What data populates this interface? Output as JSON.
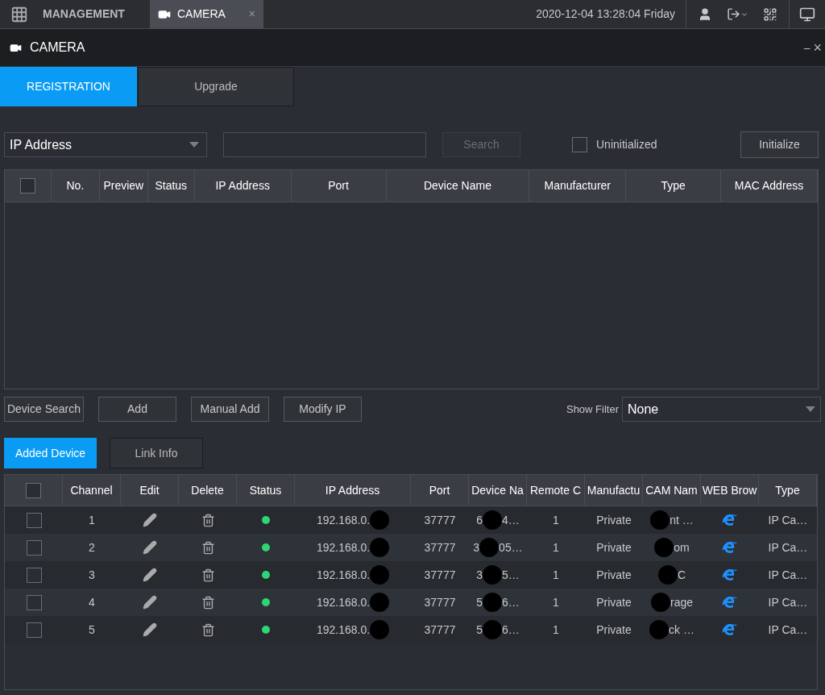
{
  "top_bar": {
    "menu_label": "MANAGEMENT",
    "tabs": [
      {
        "label": "CAMERA",
        "selected": true,
        "close": "×"
      }
    ],
    "datetime": "2020-12-04 13:28:04 Friday"
  },
  "window": {
    "title": "CAMERA",
    "minimize": "–",
    "close": "×"
  },
  "tabs": [
    {
      "label": "REGISTRATION",
      "selected": true
    },
    {
      "label": "Upgrade",
      "selected": false
    }
  ],
  "search_row": {
    "dropdown": "IP Address",
    "search_button": "Search",
    "search_disabled": true,
    "uninitialized": {
      "label": "Uninitialized",
      "checked": false
    },
    "initialize_button": "Initialize"
  },
  "found_table": {
    "select_all": {
      "checked": false
    },
    "columns": [
      "No.",
      "Preview",
      "Status",
      "IP Address",
      "Port",
      "Device Name",
      "Manufacturer",
      "Type",
      "MAC Address"
    ]
  },
  "actions": [
    "Device Search",
    "Add",
    "Manual Add",
    "Modify IP"
  ],
  "show_filter": {
    "label": "Show Filter",
    "value": "None"
  },
  "sub_tabs": [
    {
      "label": "Added Device",
      "selected": true
    },
    {
      "label": "Link Info",
      "selected": false
    }
  ],
  "added_table": {
    "select_all": {
      "checked": false
    },
    "columns": [
      "Channel",
      "Edit",
      "Delete",
      "Status",
      "IP Address",
      "Port",
      "Device Na",
      "Remote C",
      "Manufactu",
      "CAM Nam",
      "WEB Brow",
      "Type"
    ],
    "rows": [
      {
        "checked": false,
        "channel": "1",
        "online": true,
        "ip": "192.168.0.",
        "port": "37777",
        "device_pre": "6",
        "device_post": "4…",
        "remote": "1",
        "manufacturer": "Private",
        "cam_post": "nt …",
        "type": "IP Ca…"
      },
      {
        "checked": false,
        "channel": "2",
        "online": true,
        "ip": "192.168.0.",
        "port": "37777",
        "device_pre": "3",
        "device_post": "05…",
        "remote": "1",
        "manufacturer": "Private",
        "cam_post": "om",
        "type": "IP Ca…"
      },
      {
        "checked": false,
        "channel": "3",
        "online": true,
        "ip": "192.168.0.",
        "port": "37777",
        "device_pre": "3",
        "device_post": "5…",
        "remote": "1",
        "manufacturer": "Private",
        "cam_post": "C",
        "type": "IP Ca…"
      },
      {
        "checked": false,
        "channel": "4",
        "online": true,
        "ip": "192.168.0.",
        "port": "37777",
        "device_pre": "5",
        "device_post": "6…",
        "remote": "1",
        "manufacturer": "Private",
        "cam_post": "rage",
        "type": "IP Ca…"
      },
      {
        "checked": false,
        "channel": "5",
        "online": true,
        "ip": "192.168.0.",
        "port": "37777",
        "device_pre": "5",
        "device_post": "6…",
        "remote": "1",
        "manufacturer": "Private",
        "cam_post": "ck …",
        "type": "IP Ca…"
      }
    ]
  }
}
